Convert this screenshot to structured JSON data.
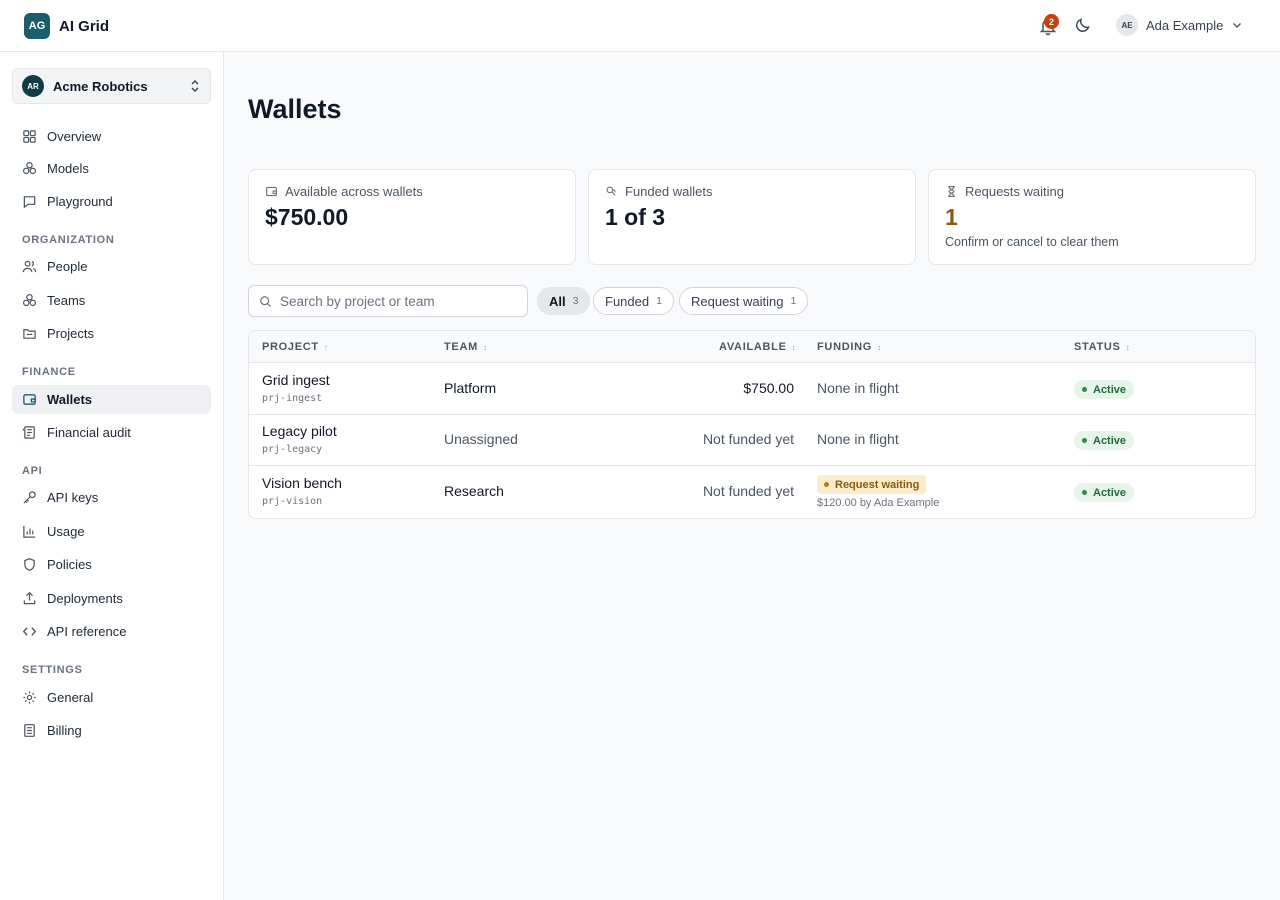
{
  "app": {
    "logo_text": "AG",
    "name": "AI Grid"
  },
  "header": {
    "notification_count": "2",
    "user_initials": "AE",
    "user_name": "Ada Example"
  },
  "sidebar": {
    "org": {
      "initials": "AR",
      "name": "Acme Robotics"
    },
    "items": [
      {
        "label": "Overview",
        "icon": "grid-icon"
      },
      {
        "label": "Models",
        "icon": "cubes-icon"
      },
      {
        "label": "Playground",
        "icon": "chat-icon"
      }
    ],
    "sections": [
      {
        "title": "ORGANIZATION",
        "items": [
          {
            "label": "People",
            "icon": "users-icon"
          },
          {
            "label": "Teams",
            "icon": "cubes-icon"
          },
          {
            "label": "Projects",
            "icon": "folder-icon"
          }
        ]
      },
      {
        "title": "FINANCE",
        "items": [
          {
            "label": "Wallets",
            "icon": "wallet-icon",
            "active": true
          },
          {
            "label": "Financial audit",
            "icon": "ledger-icon"
          }
        ]
      },
      {
        "title": "API",
        "items": [
          {
            "label": "API keys",
            "icon": "key-icon"
          },
          {
            "label": "Usage",
            "icon": "bar-chart-icon"
          },
          {
            "label": "Policies",
            "icon": "shield-icon"
          },
          {
            "label": "Deployments",
            "icon": "upload-icon"
          },
          {
            "label": "API reference",
            "icon": "code-icon"
          }
        ]
      },
      {
        "title": "SETTINGS",
        "items": [
          {
            "label": "General",
            "icon": "gear-icon"
          },
          {
            "label": "Billing",
            "icon": "receipt-icon"
          }
        ]
      }
    ]
  },
  "page": {
    "title": "Wallets"
  },
  "cards": [
    {
      "label": "Available across wallets",
      "value": "$750.00",
      "sub": ""
    },
    {
      "label": "Funded wallets",
      "value": "1 of 3",
      "sub": ""
    },
    {
      "label": "Requests waiting",
      "value": "1",
      "sub": "Confirm or cancel to clear them"
    }
  ],
  "search": {
    "placeholder": "Search by project or team",
    "value": ""
  },
  "filters": [
    {
      "label": "All",
      "count": "3",
      "active": true
    },
    {
      "label": "Funded",
      "count": "1",
      "active": false
    },
    {
      "label": "Request waiting",
      "count": "1",
      "active": false
    }
  ],
  "table": {
    "headers": {
      "project": "PROJECT",
      "project_sort": "↑",
      "team": "TEAM",
      "team_sort": "↕",
      "available": "AVAILABLE",
      "available_sort": "↕",
      "funding": "FUNDING",
      "funding_sort": "↕",
      "status": "STATUS",
      "status_sort": "↕"
    },
    "rows": [
      {
        "name": "Grid ingest",
        "slug": "prj-ingest",
        "team": "Platform",
        "available": "$750.00",
        "funding": "None in flight",
        "status": "Active"
      },
      {
        "name": "Legacy pilot",
        "slug": "prj-legacy",
        "team": "Unassigned",
        "available": "Not funded yet",
        "funding": "None in flight",
        "status": "Active"
      },
      {
        "name": "Vision bench",
        "slug": "prj-vision",
        "team": "Research",
        "available": "Not funded yet",
        "funding_badge": "Request waiting",
        "funding_detail": "$120.00 by Ada Example",
        "status": "Active"
      }
    ]
  },
  "colors": {
    "brand": "#1c5d6b",
    "badge": "#c2410c",
    "active_green": "#1f6b3a",
    "waiting_amber": "#8a5a12"
  }
}
